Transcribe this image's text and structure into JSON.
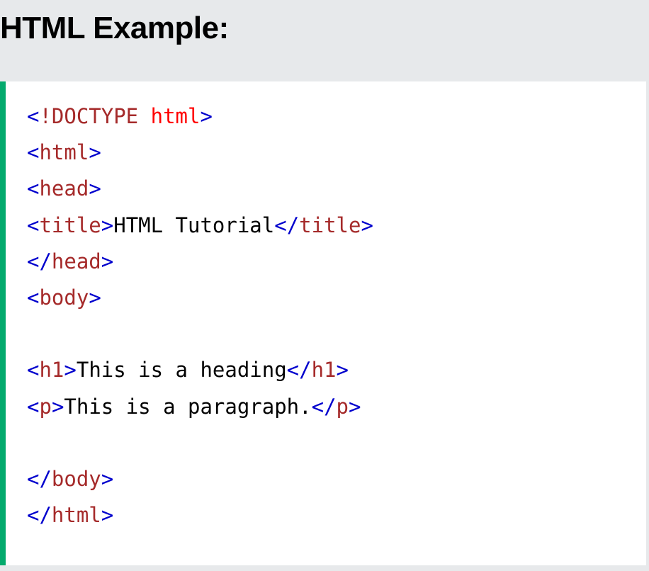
{
  "heading": {
    "title": "HTML Example:"
  },
  "colors": {
    "accent_border": "#04aa6d",
    "bracket": "#0000cd",
    "tag_name": "#a52a2a",
    "attribute": "#ff0000",
    "text": "#000000"
  },
  "code": {
    "lines": [
      [
        {
          "t": "<",
          "c": "bracket"
        },
        {
          "t": "!DOCTYPE",
          "c": "tag"
        },
        {
          "t": " ",
          "c": "text"
        },
        {
          "t": "html",
          "c": "attr"
        },
        {
          "t": ">",
          "c": "bracket"
        }
      ],
      [
        {
          "t": "<",
          "c": "bracket"
        },
        {
          "t": "html",
          "c": "tag"
        },
        {
          "t": ">",
          "c": "bracket"
        }
      ],
      [
        {
          "t": "<",
          "c": "bracket"
        },
        {
          "t": "head",
          "c": "tag"
        },
        {
          "t": ">",
          "c": "bracket"
        }
      ],
      [
        {
          "t": "<",
          "c": "bracket"
        },
        {
          "t": "title",
          "c": "tag"
        },
        {
          "t": ">",
          "c": "bracket"
        },
        {
          "t": "HTML Tutorial",
          "c": "text"
        },
        {
          "t": "</",
          "c": "bracket"
        },
        {
          "t": "title",
          "c": "tag"
        },
        {
          "t": ">",
          "c": "bracket"
        }
      ],
      [
        {
          "t": "</",
          "c": "bracket"
        },
        {
          "t": "head",
          "c": "tag"
        },
        {
          "t": ">",
          "c": "bracket"
        }
      ],
      [
        {
          "t": "<",
          "c": "bracket"
        },
        {
          "t": "body",
          "c": "tag"
        },
        {
          "t": ">",
          "c": "bracket"
        }
      ],
      [],
      [
        {
          "t": "<",
          "c": "bracket"
        },
        {
          "t": "h1",
          "c": "tag"
        },
        {
          "t": ">",
          "c": "bracket"
        },
        {
          "t": "This is a heading",
          "c": "text"
        },
        {
          "t": "</",
          "c": "bracket"
        },
        {
          "t": "h1",
          "c": "tag"
        },
        {
          "t": ">",
          "c": "bracket"
        }
      ],
      [
        {
          "t": "<",
          "c": "bracket"
        },
        {
          "t": "p",
          "c": "tag"
        },
        {
          "t": ">",
          "c": "bracket"
        },
        {
          "t": "This is a paragraph.",
          "c": "text"
        },
        {
          "t": "</",
          "c": "bracket"
        },
        {
          "t": "p",
          "c": "tag"
        },
        {
          "t": ">",
          "c": "bracket"
        }
      ],
      [],
      [
        {
          "t": "</",
          "c": "bracket"
        },
        {
          "t": "body",
          "c": "tag"
        },
        {
          "t": ">",
          "c": "bracket"
        }
      ],
      [
        {
          "t": "</",
          "c": "bracket"
        },
        {
          "t": "html",
          "c": "tag"
        },
        {
          "t": ">",
          "c": "bracket"
        }
      ]
    ]
  }
}
